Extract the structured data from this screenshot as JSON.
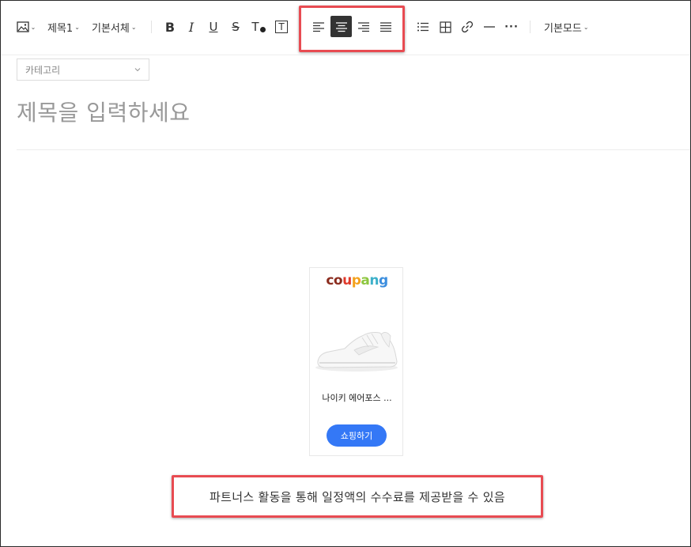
{
  "toolbar": {
    "image_button": "image-icon",
    "heading_select": "제목1",
    "font_select": "기본서체",
    "bold": "B",
    "italic": "I",
    "underline": "U",
    "strike": "S",
    "text_color": "T",
    "text_bg": "T",
    "mode_select": "기본모드",
    "more": "···",
    "active_align": "center"
  },
  "editor": {
    "category_placeholder": "카테고리",
    "title_placeholder": "제목을 입력하세요"
  },
  "product_card": {
    "brand_letters": [
      {
        "ch": "c",
        "color": "#8b2c1e"
      },
      {
        "ch": "o",
        "color": "#8b2c1e"
      },
      {
        "ch": "u",
        "color": "#e0392b"
      },
      {
        "ch": "p",
        "color": "#f4a21e"
      },
      {
        "ch": "a",
        "color": "#8dc63f"
      },
      {
        "ch": "n",
        "color": "#3cb0c9"
      },
      {
        "ch": "g",
        "color": "#3c8ede"
      }
    ],
    "product_name": "나이키 에어포스 ...",
    "button_label": "쇼핑하기"
  },
  "disclaimer": "파트너스 활동을 통해 일정액의 수수료를 제공받을 수 있음",
  "colors": {
    "highlight": "#e84b52",
    "shop_button": "#3478f6",
    "active_tool": "#333333"
  }
}
